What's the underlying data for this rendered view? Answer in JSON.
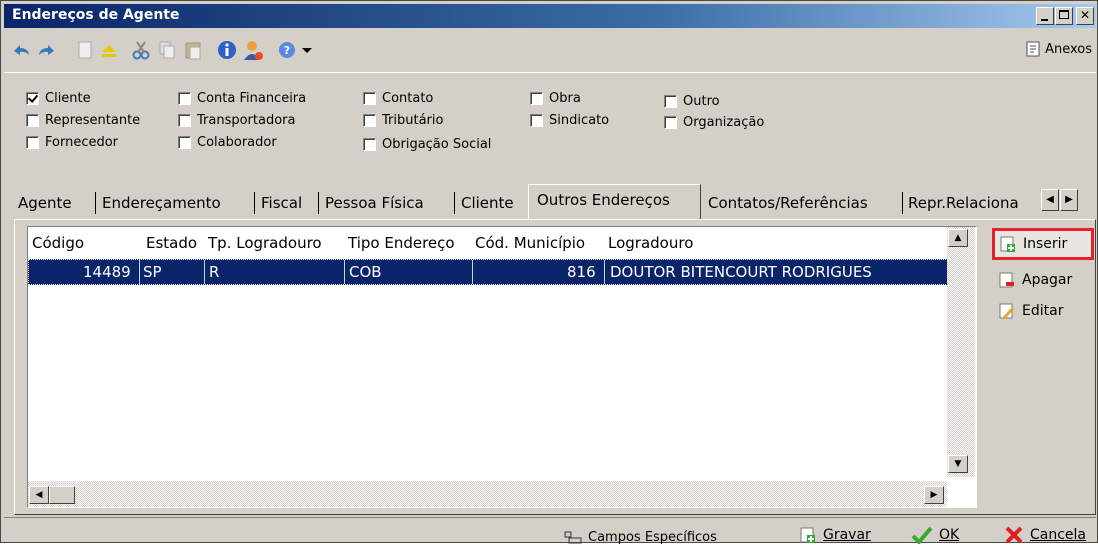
{
  "window": {
    "title": "Endereços de Agente",
    "controls": [
      "minimize",
      "maximize",
      "close"
    ]
  },
  "toolbar": {
    "icons": [
      "undo-icon",
      "redo-icon",
      "new-document-icon",
      "eject-icon",
      "cut-icon",
      "copy-icon",
      "paste-icon",
      "info-icon",
      "user-icon",
      "help-icon",
      "dropdown-icon"
    ],
    "anexos_label": "Anexos"
  },
  "checkboxes": [
    {
      "label": "Cliente",
      "checked": true
    },
    {
      "label": "Representante",
      "checked": false
    },
    {
      "label": "Fornecedor",
      "checked": false
    },
    {
      "label": "Conta Financeira",
      "checked": false
    },
    {
      "label": "Transportadora",
      "checked": false
    },
    {
      "label": "Colaborador",
      "checked": false
    },
    {
      "label": "Contato",
      "checked": false
    },
    {
      "label": "Tributário",
      "checked": false
    },
    {
      "label": "Obrigação Social",
      "checked": false
    },
    {
      "label": "Obra",
      "checked": false
    },
    {
      "label": "Sindicato",
      "checked": false
    },
    {
      "label": "Outro",
      "checked": false
    },
    {
      "label": "Organização",
      "checked": false
    }
  ],
  "tabs": [
    {
      "label": "Agente"
    },
    {
      "label": "Endereçamento"
    },
    {
      "label": "Fiscal"
    },
    {
      "label": "Pessoa Física"
    },
    {
      "label": "Cliente"
    },
    {
      "label": "Outros Endereços",
      "active": true
    },
    {
      "label": "Contatos/Referências"
    },
    {
      "label": "Repr.Relaciona"
    }
  ],
  "grid": {
    "columns": [
      "Código",
      "Estado",
      "Tp. Logradouro",
      "Tipo Endereço",
      "Cód. Município",
      "Logradouro"
    ],
    "rows": [
      {
        "codigo": "14489",
        "estado": "SP",
        "tp_logradouro": "R",
        "tipo_endereco": "COB",
        "cod_municipio": "816",
        "logradouro": "DOUTOR BITENCOURT RODRIGUES"
      }
    ]
  },
  "side_buttons": {
    "inserir": "Inserir",
    "apagar": "Apagar",
    "editar": "Editar"
  },
  "bottom": {
    "campos": "Campos Específicos",
    "gravar": "Gravar",
    "ok": "OK",
    "cancela": "Cancela"
  },
  "colors": {
    "titlebar": "#0a246a",
    "selection": "#0a246a",
    "highlight_outline": "#e8202a",
    "face": "#d4d0c8"
  }
}
